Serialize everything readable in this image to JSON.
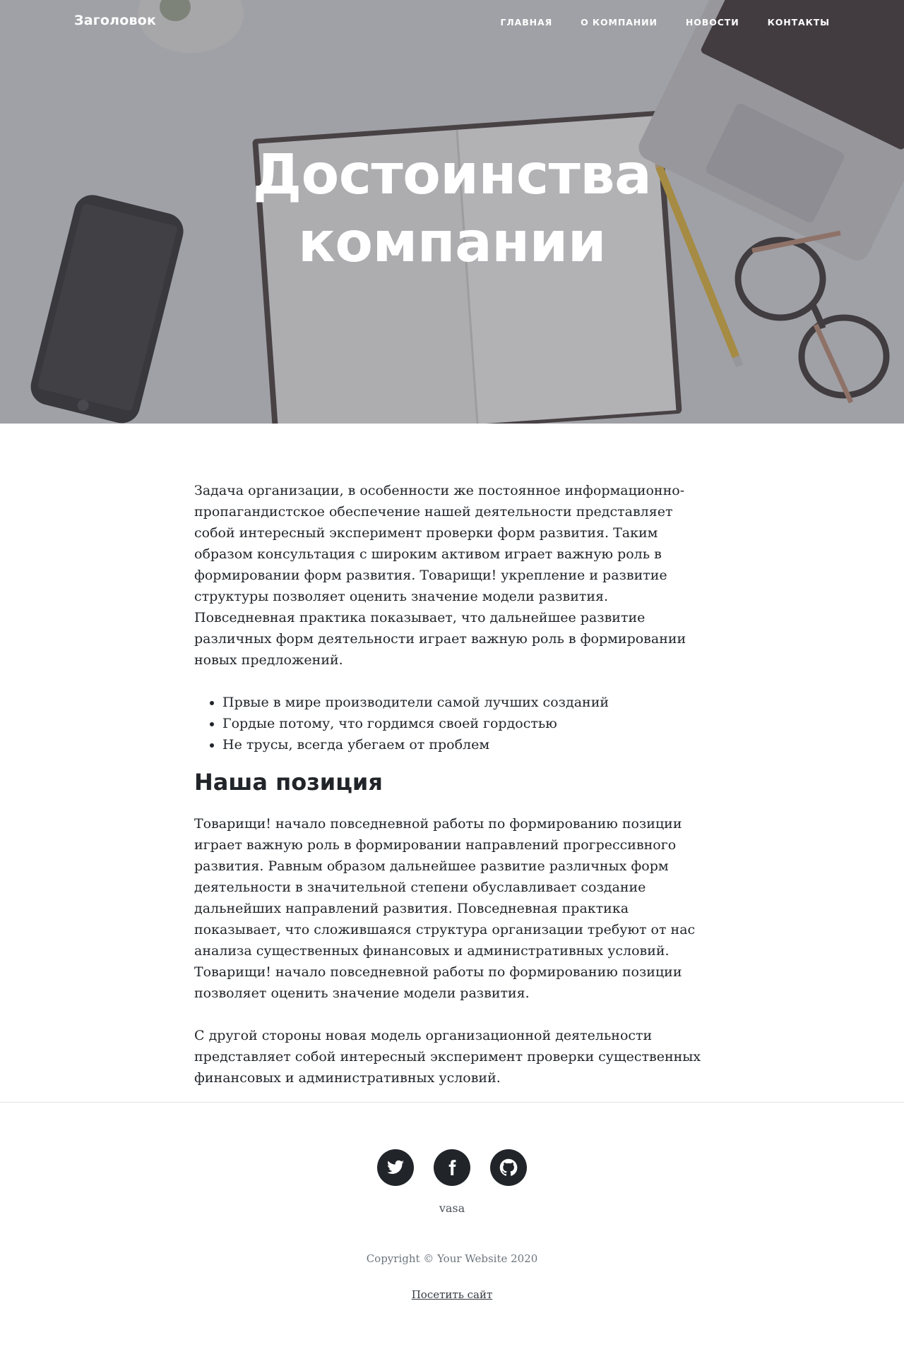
{
  "navbar": {
    "brand": "Заголовок",
    "links": [
      "ГЛАВНАЯ",
      "О КОМПАНИИ",
      "НОВОСТИ",
      "КОНТАКТЫ"
    ]
  },
  "hero": {
    "title_line1": "Достоинства",
    "title_line2": "компании"
  },
  "article": {
    "intro": "Задача организации, в особенности же постоянное информационно-пропагандистское обеспечение нашей деятельности представляет собой интересный эксперимент проверки форм развития. Таким образом консультация с широким активом играет важную роль в формировании форм развития. Товарищи! укрепление и развитие структуры позволяет оценить значение модели развития. Повседневная практика показывает, что дальнейшее развитие различных форм деятельности играет важную роль в формировании новых предложений.",
    "bullets": [
      "Првые в мире производители самой лучших созданий",
      "Гордые потому, что гордимся своей гордостью",
      "Не трусы, всегда убегаем от проблем"
    ],
    "heading": "Наша позиция",
    "paragraph2": "Товарищи! начало повседневной работы по формированию позиции играет важную роль в формировании направлений прогрессивного развития. Равным образом дальнейшее развитие различных форм деятельности в значительной степени обуславливает создание дальнейших направлений развития. Повседневная практика показывает, что сложившаяся структура организации требуют от нас анализа существенных финансовых и административных условий. Товарищи! начало повседневной работы по формированию позиции позволяет оценить значение модели развития.",
    "paragraph3": "С другой стороны новая модель организационной деятельности представляет собой интересный эксперимент проверки существенных финансовых и административных условий."
  },
  "footer": {
    "social_icons": [
      "twitter-icon",
      "facebook-icon",
      "github-icon"
    ],
    "name": "vasa",
    "copyright": "Copyright © Your Website 2020",
    "visit_link": "Посетить сайт"
  },
  "colors": {
    "text": "#212529",
    "social_bg": "#212529",
    "hero_overlay": "#5a5c64"
  }
}
